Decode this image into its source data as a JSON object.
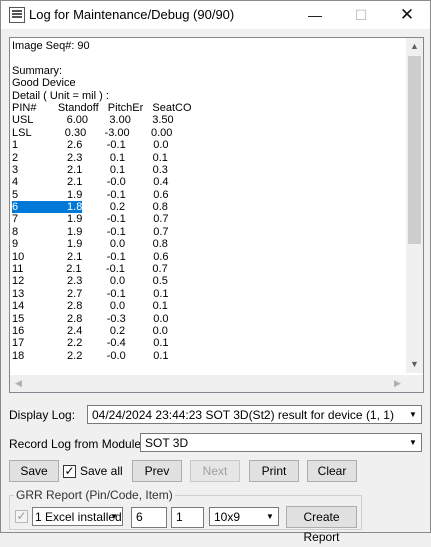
{
  "window": {
    "title": "Log for Maintenance/Debug (90/90)",
    "minimize_glyph": "—",
    "maximize_glyph": "☐",
    "close_glyph": "✕"
  },
  "log": {
    "lines": [
      "Image Seq#: 90",
      "",
      "Summary:",
      "Good Device",
      "Detail ( Unit = mil ) :",
      "PIN#       Standoff   PitchEr   SeatCO",
      "USL           6.00       3.00       3.50",
      "LSL           0.30      -3.00       0.00",
      "1                2.6        -0.1         0.0",
      "2                2.3         0.1         0.1",
      "3                2.1         0.1         0.3",
      "4                2.1        -0.0         0.4",
      "5                1.9        -0.1         0.6",
      "6                1.8         0.2         0.8",
      "7                1.9        -0.1         0.7",
      "8                1.9        -0.1         0.7",
      "9                1.9         0.0         0.8",
      "10              2.1        -0.1         0.6",
      "11              2.1        -0.1         0.7",
      "12              2.3         0.0         0.5",
      "13              2.7        -0.1         0.1",
      "14              2.8         0.0         0.1",
      "15              2.8        -0.3         0.0",
      "16              2.4         0.2         0.0",
      "17              2.2        -0.4         0.1",
      "18              2.2        -0.0         0.1"
    ],
    "selected_line_index": 13,
    "selected_text": "6                1.8"
  },
  "display_log": {
    "label": "Display Log:",
    "value": "04/24/2024 23:44:23 SOT 3D(St2) result for device (1, 1)"
  },
  "record_log": {
    "label": "Record Log from Module:",
    "value": "SOT 3D"
  },
  "buttons": {
    "save": "Save",
    "save_all": "Save all",
    "save_all_checked": true,
    "prev": "Prev",
    "next": "Next",
    "print": "Print",
    "clear": "Clear"
  },
  "grr": {
    "title": "GRR Report (Pin/Code, Item)",
    "checked": true,
    "excel": "1 Excel installed",
    "pin_code": "6",
    "item": "1",
    "size": "10x9",
    "create_report": "Create Report"
  }
}
